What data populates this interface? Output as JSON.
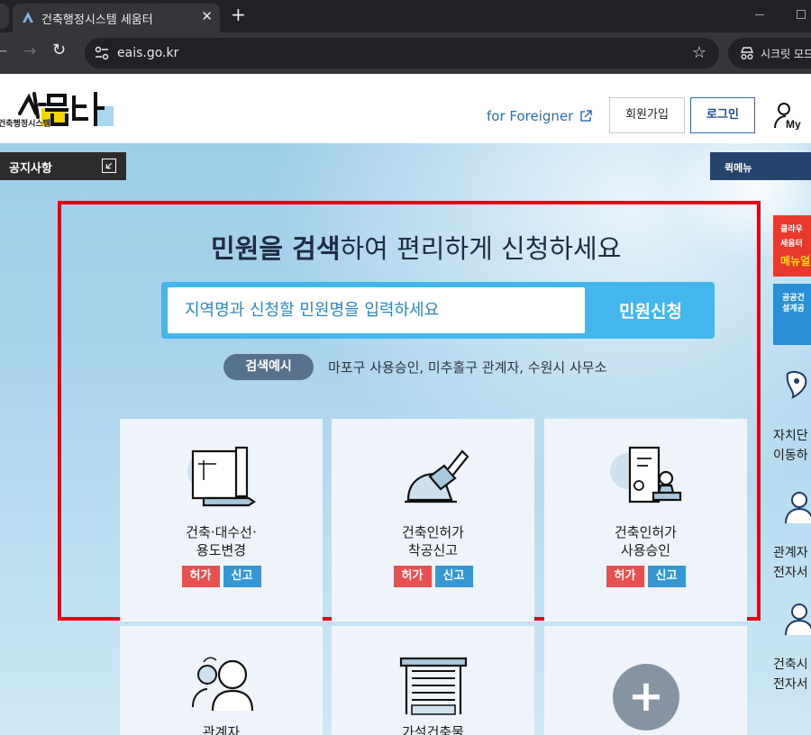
{
  "browser": {
    "tab_title": "건축행정시스템 세움터",
    "tab_close": "✕",
    "new_tab": "+",
    "url": "eais.go.kr",
    "incognito_label": "시크릿 모드"
  },
  "header": {
    "logo_text": "건축행정시스템",
    "foreigner_link": "for Foreigner",
    "join_label": "회원가입",
    "login_label": "로그인"
  },
  "hero": {
    "notice_label": "공지사항",
    "quick_label": "퀵메뉴",
    "headline_bold": "민원을 검색",
    "headline_rest": "하여 편리하게 신청하세요",
    "search_placeholder": "지역명과 신청할 민원명을 입력하세요",
    "search_button": "민원신청",
    "example_badge": "검색예시",
    "example_text": "마포구 사용승인, 미추홀구 관계자, 수원시 사무소"
  },
  "cards": [
    {
      "title": "건축·대수선·\n용도변경",
      "tag1": "허가",
      "tag2": "신고"
    },
    {
      "title": "건축인허가\n착공신고",
      "tag1": "허가",
      "tag2": "신고"
    },
    {
      "title": "건축인허가\n사용승인",
      "tag1": "허가",
      "tag2": "신고"
    }
  ],
  "cards_row2": [
    {
      "title": "관계자"
    },
    {
      "title": "가설건축물"
    },
    {
      "title": "+"
    }
  ],
  "side": {
    "banner1_lines": [
      "클라우",
      "세움터",
      "메뉴얼"
    ],
    "banner2_lines": [
      "공공건",
      "설계공"
    ],
    "item1_lines": [
      "자치단",
      "이동하"
    ],
    "item2_lines": [
      "관계자",
      "전자서"
    ],
    "item3_lines": [
      "건축시",
      "전자서"
    ]
  },
  "colors": {
    "accent_blue": "#44b6ee",
    "highlight_red": "#e60012",
    "tag_red": "#ea4f4f",
    "tag_blue": "#3597d3"
  }
}
